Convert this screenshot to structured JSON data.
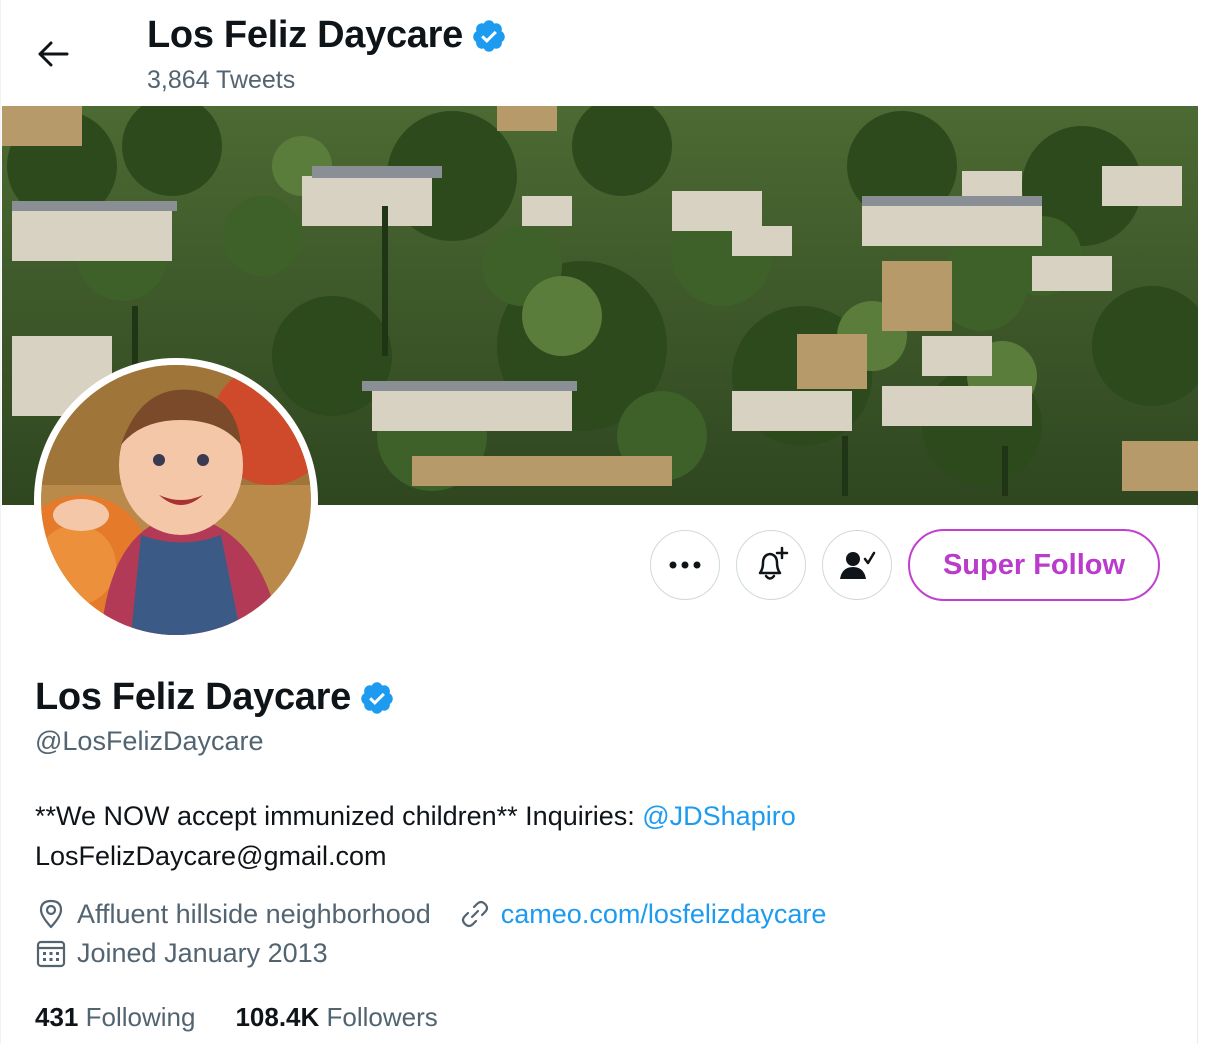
{
  "header": {
    "title": "Los Feliz Daycare",
    "tweet_count": "3,864 Tweets"
  },
  "actions": {
    "super_follow_label": "Super Follow"
  },
  "profile": {
    "name": "Los Feliz Daycare",
    "handle": "@LosFelizDaycare",
    "bio_text": "**We NOW accept immunized children** Inquiries: ",
    "bio_mention": "@JDShapiro",
    "bio_email": "LosFelizDaycare@gmail.com",
    "location": "Affluent hillside neighborhood",
    "website": "cameo.com/losfelizdaycare",
    "joined": "Joined January 2013"
  },
  "stats": {
    "following_count": "431",
    "following_label": "Following",
    "followers_count": "108.4K",
    "followers_label": "Followers"
  },
  "colors": {
    "verified": "#1d9bf0",
    "link": "#1d9bf0",
    "super_follow": "#c13fd1",
    "secondary_text": "#536471"
  }
}
